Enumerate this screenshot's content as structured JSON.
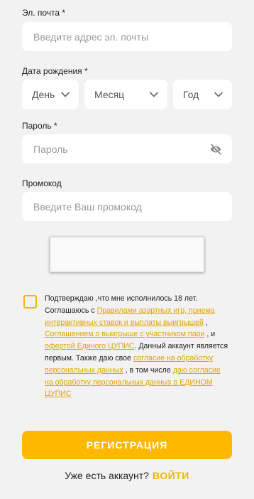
{
  "email": {
    "label": "Эл. почта *",
    "placeholder": "Введите адрес эл. почты"
  },
  "birthdate": {
    "label": "Дата рождения *",
    "day": "День",
    "month": "Месяц",
    "year": "Год"
  },
  "password": {
    "label": "Пароль *",
    "placeholder": "Пароль"
  },
  "promo": {
    "label": "Промокод",
    "placeholder": "Введите Ваш промокод"
  },
  "consent": {
    "t1": "Подтверждаю ,что мне исполнилось 18 лет. Соглашаюсь с ",
    "l1": "Правилами азартных игр, приема интерактивных ставок и выплаты выигрышей",
    "t2": " , ",
    "l2": "Соглашением о выигрыше с участником пари",
    "t3": " , и ",
    "l3": "офертой Единого ЦУПИС",
    "t4": ". Данный аккаунт является первым. Также даю свое ",
    "l4": "согласие на обработку персональных данных",
    "t5": " , в том числе ",
    "l5": "даю согласие на обработку персональных данных в ЕДИНОМ  ЦУПИС"
  },
  "register_label": "РЕГИСТРАЦИЯ",
  "login": {
    "text": "Уже есть аккаунт?",
    "link": "ВОЙТИ"
  },
  "colors": {
    "accent": "#ffb800",
    "link": "#e0a400",
    "background": "#f2f2f2"
  }
}
